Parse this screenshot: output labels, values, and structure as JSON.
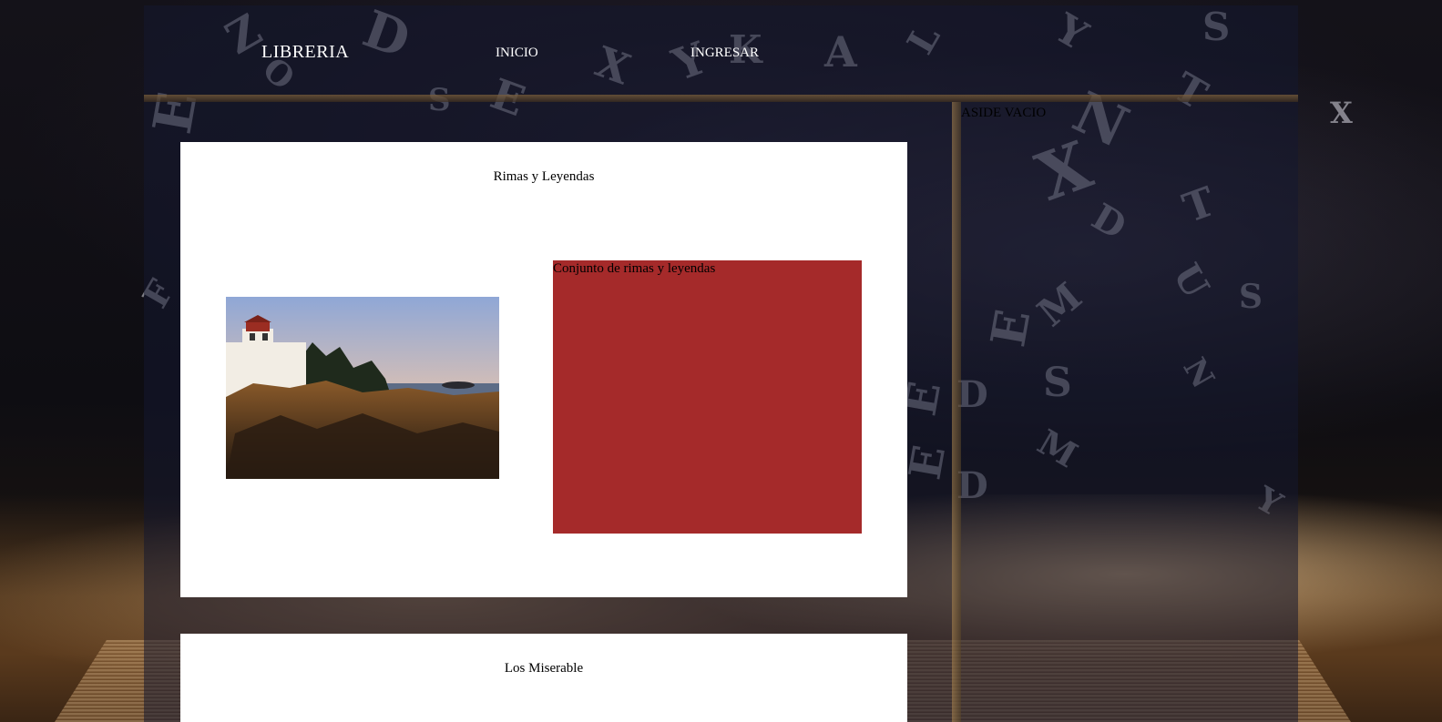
{
  "header": {
    "brand": "LIBRERIA",
    "nav": [
      {
        "label": "INICIO"
      },
      {
        "label": "INGRESAR"
      }
    ]
  },
  "aside": {
    "title": "ASIDE VACIO"
  },
  "books": [
    {
      "title": "Rimas y Leyendas",
      "image_alt": "lighthouse-photo",
      "description": "Conjunto de rimas y leyendas"
    },
    {
      "title": "Los Miserable"
    }
  ],
  "colors": {
    "description_box": "#a52a2a",
    "card_background": "#ffffff",
    "nav_text": "#ffffff"
  }
}
